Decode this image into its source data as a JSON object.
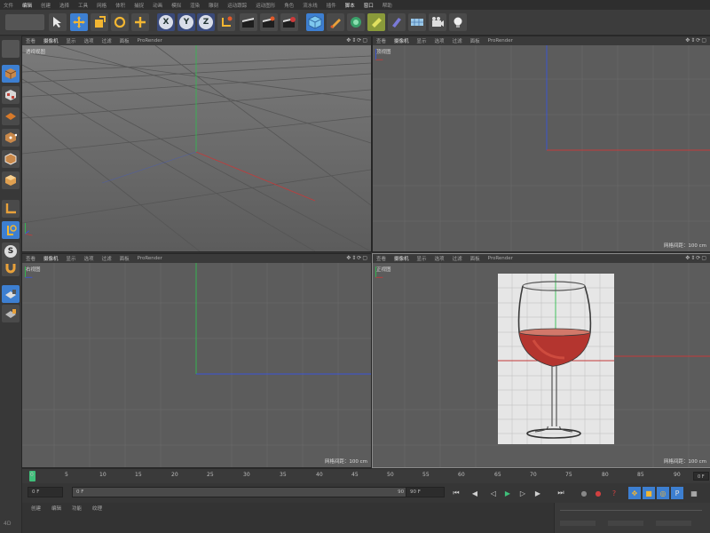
{
  "menubar": {
    "items": [
      "文件",
      "编辑",
      "创建",
      "选择",
      "工具",
      "网格",
      "体积",
      "捕捉",
      "动画",
      "模拟",
      "渲染",
      "雕刻",
      "运动跟踪",
      "运动图形",
      "角色",
      "流水线",
      "插件",
      "脚本",
      "窗口",
      "帮助"
    ]
  },
  "toolbar": {
    "axis_x": "X",
    "axis_y": "Y",
    "axis_z": "Z"
  },
  "viewports": [
    {
      "menu": [
        "查看",
        "摄像机",
        "显示",
        "选项",
        "过滤",
        "面板",
        "ProRender"
      ],
      "label": "透视视图",
      "scale": ""
    },
    {
      "menu": [
        "查看",
        "摄像机",
        "显示",
        "选项",
        "过滤",
        "面板",
        "ProRender"
      ],
      "label": "顶视图",
      "scale": "网格间距：100 cm"
    },
    {
      "menu": [
        "查看",
        "摄像机",
        "显示",
        "选项",
        "过滤",
        "面板",
        "ProRender"
      ],
      "label": "右视图",
      "scale": "网格间距：100 cm"
    },
    {
      "menu": [
        "查看",
        "摄像机",
        "显示",
        "选项",
        "过滤",
        "面板",
        "ProRender"
      ],
      "label": "正视图",
      "scale": "网格间距：100 cm"
    }
  ],
  "timeline": {
    "ticks": [
      "0",
      "5",
      "10",
      "15",
      "20",
      "25",
      "30",
      "35",
      "40",
      "45",
      "50",
      "55",
      "60",
      "65",
      "70",
      "75",
      "80",
      "85",
      "90"
    ],
    "current_frame": "0 F",
    "start_frame": "0 F",
    "end_frame": "90 F",
    "range_end": "90 F",
    "right_field": "0 F"
  },
  "bottom_tabs": [
    "创建",
    "编辑",
    "功能",
    "纹理"
  ],
  "colors": {
    "viewport_bg": "#5c5c5c",
    "grid": "#6a6a6a",
    "axis_x": "#c43a3a",
    "axis_y": "#2fbf4f",
    "axis_z": "#3a55d8",
    "accent_blue": "#3d7fd1",
    "wine": "#b4352f"
  }
}
